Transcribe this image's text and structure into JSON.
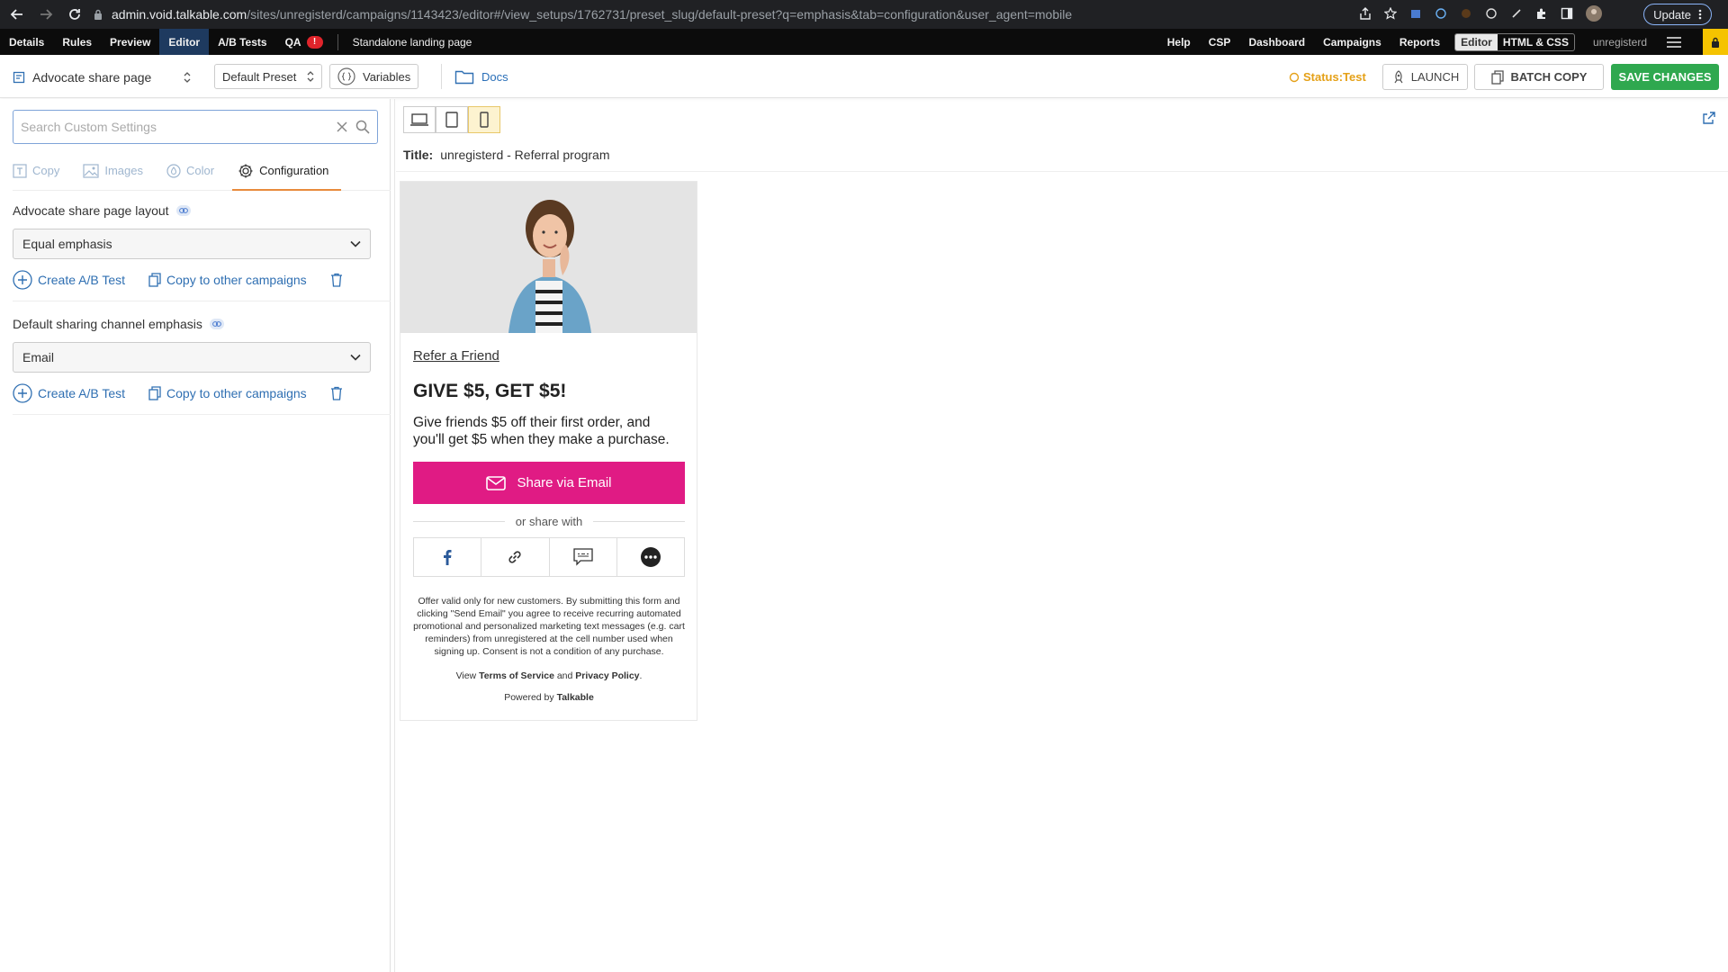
{
  "browser": {
    "url_host": "admin.void.talkable.com",
    "url_path": "/sites/unregisterd/campaigns/1143423/editor#/view_setups/1762731/preset_slug/default-preset?q=emphasis&tab=configuration&user_agent=mobile",
    "update_label": "Update"
  },
  "app_nav": {
    "left_items": [
      "Details",
      "Rules",
      "Preview",
      "Editor",
      "A/B Tests"
    ],
    "qa_label": "QA",
    "qa_badge": "!",
    "campaign_name": "Standalone landing page",
    "right_items": [
      "Help",
      "CSP",
      "Dashboard",
      "Campaigns",
      "Reports"
    ],
    "editor_toggle": [
      "Editor",
      "HTML & CSS"
    ],
    "user": "unregisterd"
  },
  "toolbar": {
    "page_label": "Advocate share page",
    "preset_label": "Default Preset",
    "variables_label": "Variables",
    "docs_label": "Docs",
    "status_label": "Status:Test",
    "launch_label": "LAUNCH",
    "batch_copy_label": "BATCH COPY",
    "save_label": "SAVE CHANGES"
  },
  "sidebar": {
    "search_placeholder": "Search Custom Settings",
    "tabs": [
      {
        "label": "Copy",
        "icon": "text-icon"
      },
      {
        "label": "Images",
        "icon": "image-icon"
      },
      {
        "label": "Color",
        "icon": "drop-icon"
      },
      {
        "label": "Configuration",
        "icon": "gear-icon"
      }
    ],
    "settings": [
      {
        "label": "Advocate share page layout",
        "value": "Equal emphasis",
        "ab_label": "Create A/B Test",
        "copy_label": "Copy to other campaigns"
      },
      {
        "label": "Default sharing channel emphasis",
        "value": "Email",
        "ab_label": "Create A/B Test",
        "copy_label": "Copy to other campaigns"
      }
    ]
  },
  "preview": {
    "title_label": "Title:",
    "title_value": "unregisterd - Referral program",
    "refer_link": "Refer a Friend",
    "headline": "GIVE $5, GET $5!",
    "description": "Give friends $5 off their first order, and you'll get $5 when they make a purchase.",
    "share_button": "Share via Email",
    "or_share": "or share with",
    "fineprint": "Offer valid only for new customers. By submitting this form and clicking \"Send Email\" you agree to receive recurring automated promotional and personalized marketing text messages (e.g. cart reminders) from unregistered at the cell number used when signing up. Consent is not a condition of any purchase.",
    "terms_view": "View",
    "terms_link": "Terms of Service",
    "terms_and": "and",
    "privacy_link": "Privacy Policy",
    "terms_end": ".",
    "powered_by": "Powered by",
    "powered_brand": "Talkable"
  },
  "colors": {
    "share_pink": "#e01b84",
    "save_green": "#2fa84f",
    "status_orange": "#e5a118",
    "link_blue": "#2f6fb2"
  }
}
